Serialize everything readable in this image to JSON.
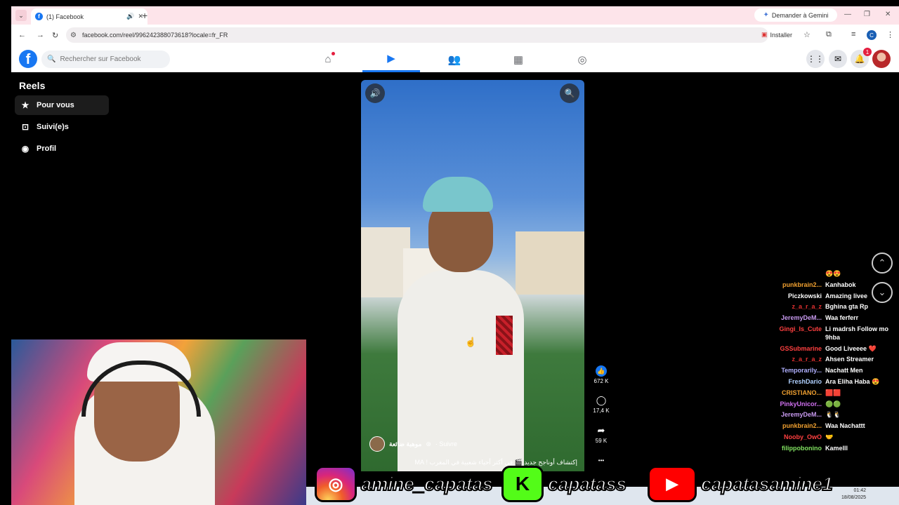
{
  "browser": {
    "tab_title": "(1) Facebook",
    "new_tab": "+",
    "url": "facebook.com/reel/996242388073618?locale=fr_FR",
    "gemini": "Demander à Gemini",
    "install": "Installer",
    "profile_initial": "C"
  },
  "facebook": {
    "search_placeholder": "Rechercher sur Facebook",
    "notif_count": "1"
  },
  "sidebar": {
    "title": "Reels",
    "items": [
      {
        "label": "Pour vous"
      },
      {
        "label": "Suivi(e)s"
      },
      {
        "label": "Profil"
      }
    ]
  },
  "reel": {
    "author": "موهبة ضائعة",
    "follow": "· Suivre",
    "caption": "إكتشاف أوناجح جديد 🎬 في أكثر أحياء شعبية في المغرب ! MA",
    "likes": "672 K",
    "comments": "17,4 K",
    "shares": "59 K",
    "more": "•••"
  },
  "chat": {
    "top_emoji": "😍😍",
    "messages": [
      {
        "user": "punkbrain2...",
        "msg": "Kanhabok",
        "color": "#f0a030"
      },
      {
        "user": "Piczkowski",
        "msg": "Amazing livee",
        "color": "#ffffff"
      },
      {
        "user": "z_a_r_a_z",
        "msg": "Bghina gta Rp",
        "color": "#e03030"
      },
      {
        "user": "JeremyDeM...",
        "msg": "Waa ferferr",
        "color": "#c89af0"
      },
      {
        "user": "Gingi_Is_Cute",
        "msg": "Li madrsh Follow mo 9hba",
        "color": "#ff4040"
      },
      {
        "user": "GSSubmarine",
        "msg": "Good Liveeee ❤️",
        "color": "#ff4040"
      },
      {
        "user": "z_a_r_a_z",
        "msg": "Ahsen Streamer",
        "color": "#e03030"
      },
      {
        "user": "Temporarily...",
        "msg": "Nachatt Men",
        "color": "#b0b0ff"
      },
      {
        "user": "FreshDario",
        "msg": "Ara Eliha Haba 😍",
        "color": "#b0d0ff"
      },
      {
        "user": "CRISTIANO...",
        "msg": "🟥🟥",
        "color": "#f0a030"
      },
      {
        "user": "PinkyUnicor...",
        "msg": "🟢🟢",
        "color": "#d070f0"
      },
      {
        "user": "JeremyDeM...",
        "msg": "🐧🐧",
        "color": "#c89af0"
      },
      {
        "user": "punkbrain2...",
        "msg": "Waa Nachattt",
        "color": "#f0a030"
      },
      {
        "user": "Nooby_OwO",
        "msg": "🤝",
        "color": "#ff4040"
      },
      {
        "user": "filippobonino",
        "msg": "Kamelll",
        "color": "#80e060"
      }
    ]
  },
  "banner": {
    "instagram": "amine_capatas",
    "kick": "capatass",
    "youtube": "capatasamine1",
    "kick_letter": "K"
  },
  "clock": {
    "time": "01:42",
    "date": "18/08/2025"
  }
}
